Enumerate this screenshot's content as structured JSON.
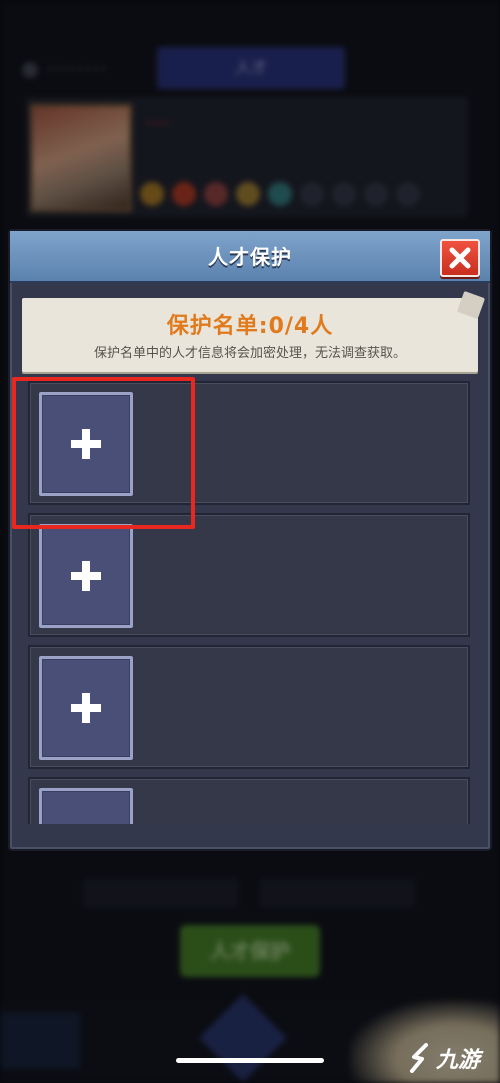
{
  "background": {
    "tab_label": "人才",
    "username": "••••••••",
    "portrait_name": "•••",
    "action_button": "人才保护"
  },
  "dialog": {
    "title": "人才保护",
    "close_icon": "close-x-icon",
    "banner": {
      "title": "保护名单:0/4人",
      "subtitle": "保护名单中的人才信息将会加密处理，无法调查获取。"
    },
    "slots": [
      {
        "state": "empty",
        "action_icon": "plus-icon"
      },
      {
        "state": "empty",
        "action_icon": "plus-icon"
      },
      {
        "state": "empty",
        "action_icon": "plus-icon"
      },
      {
        "state": "empty",
        "action_icon": "plus-icon"
      }
    ]
  },
  "overlay": {
    "highlight": "first-slot-highlight",
    "watermark_text": "九游"
  },
  "colors": {
    "accent_orange": "#e07a1c",
    "header_blue": "#6b91bd",
    "close_red": "#e0402e",
    "highlight_red": "#e8271f",
    "slot_add_bg": "#4a4f77"
  }
}
